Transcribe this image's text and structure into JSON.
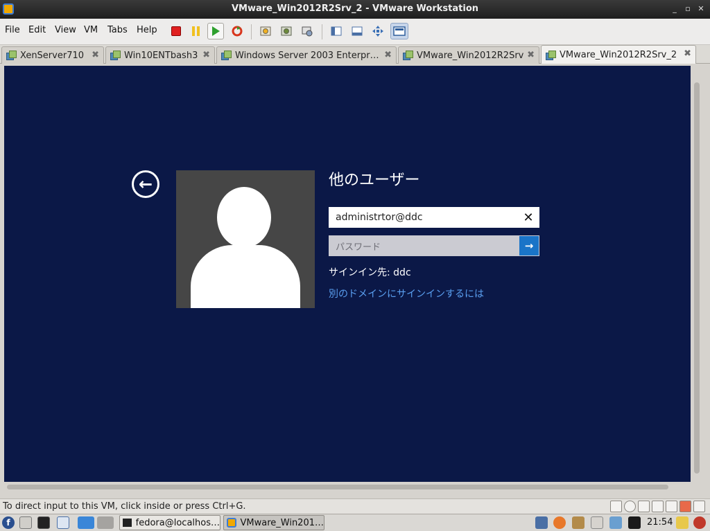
{
  "window": {
    "title": "VMware_Win2012R2Srv_2 - VMware Workstation",
    "controls": {
      "minimize": "_",
      "maximize": "▫",
      "close": "✕"
    }
  },
  "menu": {
    "file": "File",
    "edit": "Edit",
    "view": "View",
    "vm": "VM",
    "tabs": "Tabs",
    "help": "Help"
  },
  "toolbar": {
    "icons": [
      "power-off-icon",
      "suspend-icon",
      "power-on-icon",
      "reset-icon",
      "snapshot-icon",
      "revert-snapshot-icon",
      "snapshot-manager-icon",
      "show-library-icon",
      "show-thumbnail-bar-icon",
      "fit-guest-icon",
      "full-screen-icon"
    ]
  },
  "tabs": [
    {
      "label": "XenServer710",
      "active": false
    },
    {
      "label": "Win10ENTbash3",
      "active": false
    },
    {
      "label": "Windows Server 2003 Enterpr…",
      "active": false
    },
    {
      "label": "VMware_Win2012R2Srv",
      "active": false
    },
    {
      "label": "VMware_Win2012R2Srv_2",
      "active": true
    }
  ],
  "tab_close_glyph": "✖",
  "logon": {
    "back_glyph": "←",
    "heading": "他のユーザー",
    "username_value": "administrtor@ddc",
    "clear_glyph": "✕",
    "password_placeholder": "パスワード",
    "submit_glyph": "→",
    "sign_in_to": "サインイン先: ddc",
    "other_domain_link": "別のドメインにサインインするには"
  },
  "statusbar": {
    "text": "To direct input to this VM, click inside or press Ctrl+G."
  },
  "taskbar": {
    "tasks": [
      {
        "label": "fedora@localhos…",
        "active": false
      },
      {
        "label": "VMware_Win201…",
        "active": true
      }
    ],
    "clock": "21:54"
  },
  "colors": {
    "vm_background": "#0b1847",
    "accent_blue": "#1a74c8",
    "link_blue": "#5a9ff0"
  }
}
